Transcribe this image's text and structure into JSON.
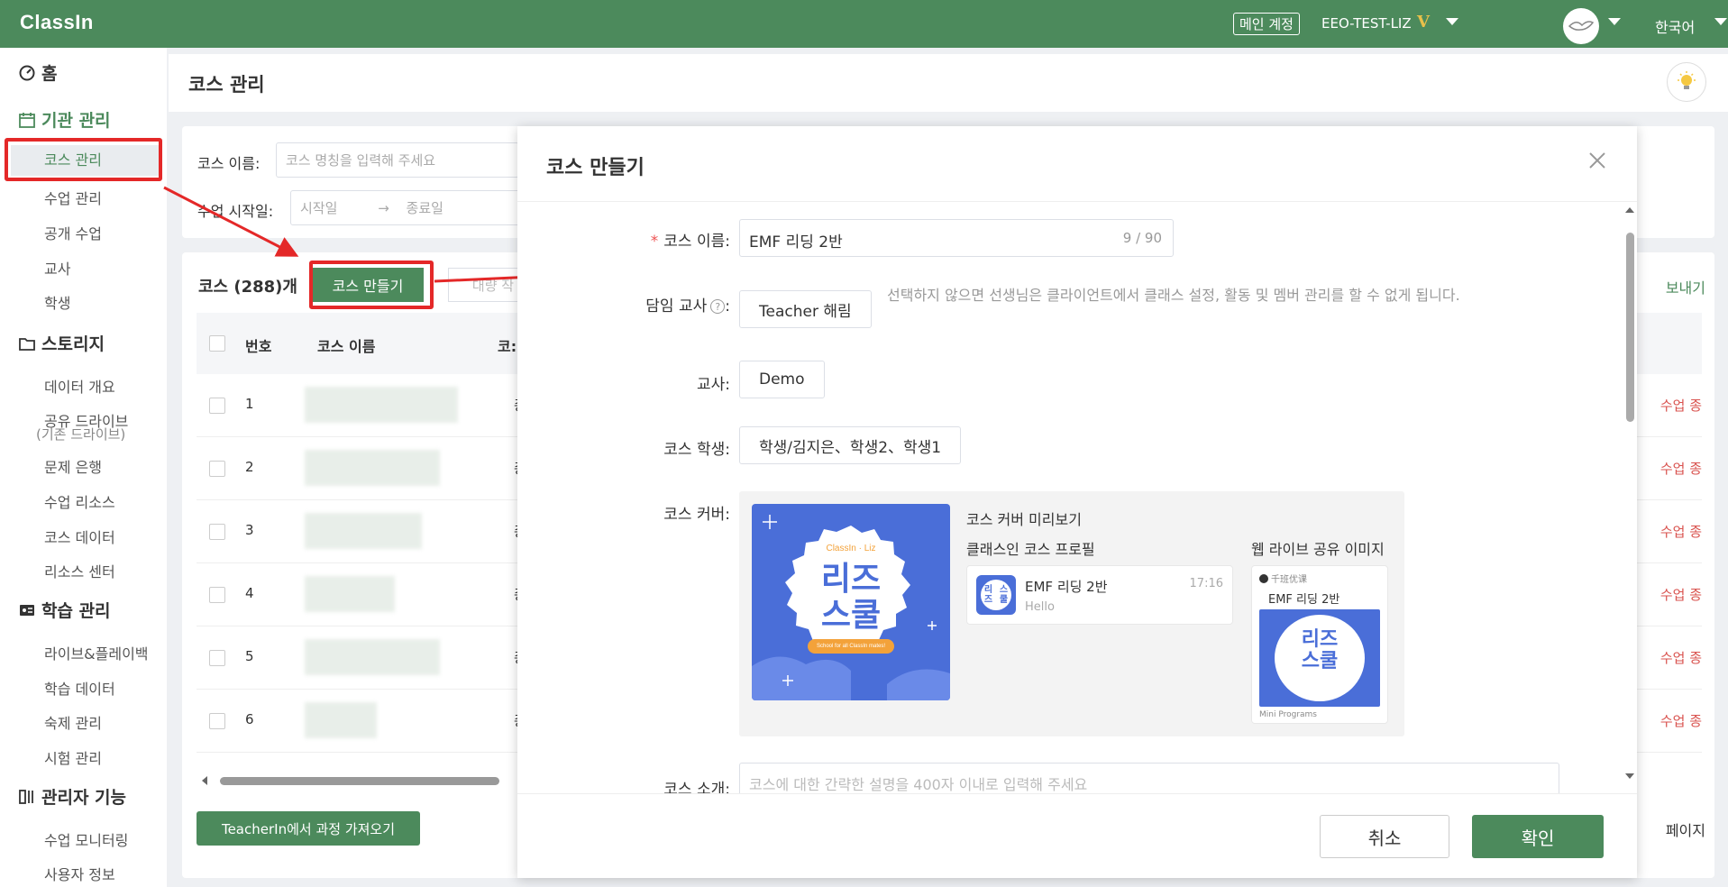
{
  "topbar": {
    "logo": "ClassIn",
    "main_account_badge": "메인 계정",
    "account_name": "EEO-TEST-LIZ",
    "vip_mark": "V",
    "language": "한국어"
  },
  "sidebar": {
    "home": "홈",
    "org_section": "기관 관리",
    "org_items": [
      "코스 관리",
      "수업 관리",
      "공개 수업",
      "교사",
      "학생"
    ],
    "storage_section": "스토리지",
    "storage_items": [
      "데이터 개요",
      "공유 드라이브",
      "문제 은행",
      "수업 리소스",
      "코스 데이터",
      "리소스 센터"
    ],
    "storage_sub": "(기존 드라이브)",
    "learning_section": "학습 관리",
    "learning_items": [
      "라이브&플레이백",
      "학습 데이터",
      "숙제 관리",
      "시험 관리"
    ],
    "admin_section": "관리자 기능",
    "admin_items": [
      "수업 모니터링",
      "사용자 정보"
    ]
  },
  "main": {
    "title": "코스 관리",
    "filter": {
      "course_name_label": "코스 이름",
      "course_name_placeholder": "코스 명칭을 입력해 주세요",
      "start_date_label": "수업 시작일",
      "start_placeholder": "시작일",
      "arrow": "→",
      "end_placeholder": "종료일"
    },
    "list": {
      "count_label": "코스 (288)개",
      "create_button": "코스 만들기",
      "batch_button": "대량 작",
      "export_link": "보내기",
      "headers": [
        "번호",
        "코스 이름",
        "코:"
      ],
      "rows": [
        {
          "num": "1",
          "status": "종:",
          "right": "수업 종"
        },
        {
          "num": "2",
          "status": "종:",
          "right": "수업 종"
        },
        {
          "num": "3",
          "status": "종:",
          "right": "수업 종"
        },
        {
          "num": "4",
          "status": "종:",
          "right": "수업 종"
        },
        {
          "num": "5",
          "status": "종:",
          "right": "수업 종"
        },
        {
          "num": "6",
          "status": "종:",
          "right": "수업 종"
        }
      ],
      "import_button": "TeacherIn에서 과정 가져오기",
      "pager": "페이지"
    }
  },
  "modal": {
    "title": "코스 만들기",
    "course_name_label": "코스 이름",
    "course_name_value": "EMF 리딩 2반",
    "course_name_count": "9 / 90",
    "homeroom_label": "담임 교사",
    "homeroom_value": "Teacher 해림",
    "homeroom_hint": "선택하지 않으면 선생님은 클라이언트에서 클래스 설정, 활동 및 멤버 관리를 할 수 없게 됩니다.",
    "teacher_label": "교사",
    "teacher_value": "Demo",
    "students_label": "코스 학생",
    "students_value": "학생/김지은、학생2、학생1",
    "cover_label": "코스 커버",
    "cover": {
      "brand": "ClassIn · Liz",
      "line1": "리즈",
      "line2": "스쿨",
      "tagline": "School for all ClassIn mates!"
    },
    "preview_title": "코스 커버 미리보기",
    "profile_title": "클래스인 코스 프로필",
    "profile_card": {
      "name": "EMF 리딩 2반",
      "sub": "Hello",
      "time": "17:16"
    },
    "share_title": "웹 라이브 공유 이미지",
    "share_card": {
      "app": "千班优课",
      "name": "EMF 리딩 2반",
      "footer": "Mini Programs"
    },
    "intro_label": "코스 소개",
    "intro_placeholder": "코스에 대한 간략한 설명을 400자 이내로 입력해 주세요",
    "cancel": "취소",
    "ok": "확인"
  },
  "colors": {
    "brand_green": "#4c8a5c",
    "highlight_red": "#e42828",
    "cover_blue": "#4a6ed8"
  }
}
